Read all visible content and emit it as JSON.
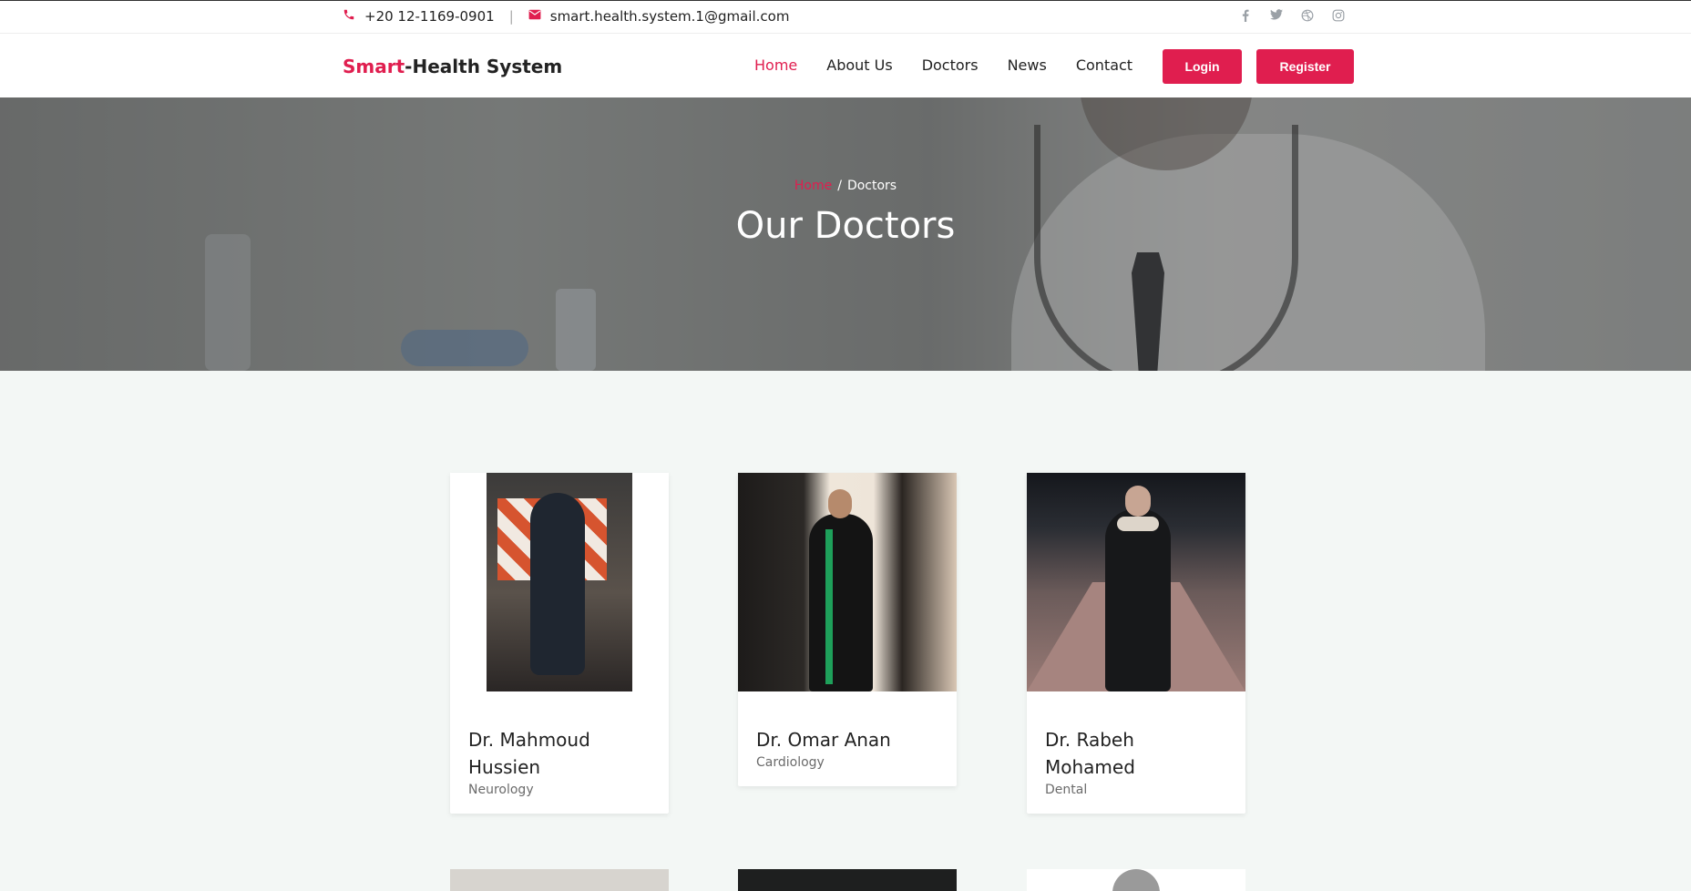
{
  "topbar": {
    "phone": "+20 12-1169-0901",
    "separator": "|",
    "email": "smart.health.system.1@gmail.com",
    "icons": [
      "phone-icon",
      "mail-icon"
    ],
    "social": [
      "facebook-icon",
      "twitter-icon",
      "dribbble-icon",
      "instagram-icon"
    ]
  },
  "navbar": {
    "brand_accent": "Smart",
    "brand_rest": "-Health System",
    "links": [
      {
        "label": "Home",
        "active": true
      },
      {
        "label": "About Us",
        "active": false
      },
      {
        "label": "Doctors",
        "active": false
      },
      {
        "label": "News",
        "active": false
      },
      {
        "label": "Contact",
        "active": false
      }
    ],
    "login_label": "Login",
    "register_label": "Register"
  },
  "hero": {
    "breadcrumb_home": "Home",
    "breadcrumb_sep": "/",
    "breadcrumb_current": "Doctors",
    "title": "Our Doctors"
  },
  "doctors": [
    {
      "name": "Dr. Mahmoud Hussien",
      "specialty": "Neurology"
    },
    {
      "name": "Dr. Omar Anan",
      "specialty": "Cardiology"
    },
    {
      "name": "Dr. Rabeh Mohamed",
      "specialty": "Dental"
    }
  ],
  "colors": {
    "accent": "#e01e4f",
    "background": "#f3f7f5",
    "text": "#222222"
  }
}
